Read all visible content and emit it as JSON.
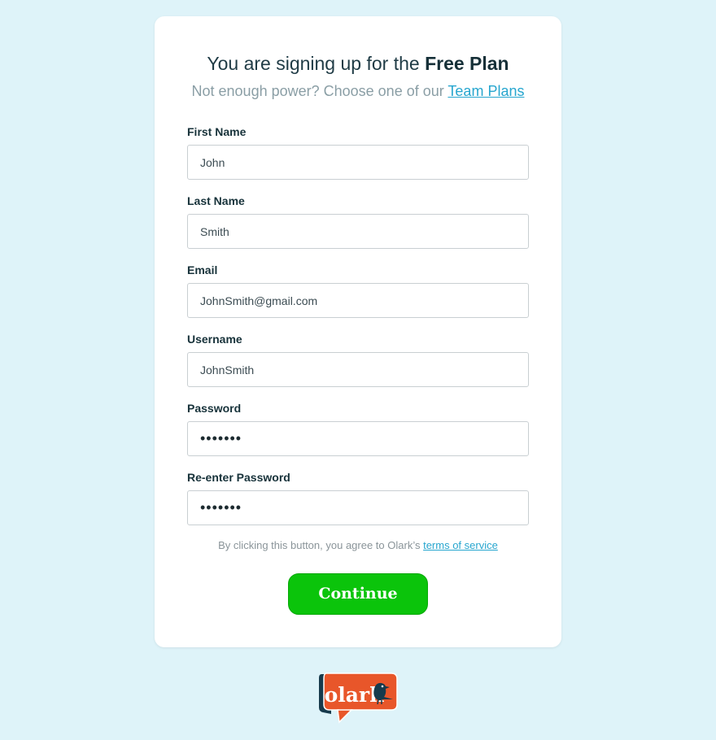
{
  "heading": {
    "prefix": "You are signing up for the ",
    "plan": "Free Plan"
  },
  "subheading": {
    "text": "Not enough power? Choose one of our ",
    "link": "Team Plans"
  },
  "form": {
    "first_name": {
      "label": "First Name",
      "value": "John"
    },
    "last_name": {
      "label": "Last Name",
      "value": "Smith"
    },
    "email": {
      "label": "Email",
      "value": "JohnSmith@gmail.com"
    },
    "username": {
      "label": "Username",
      "value": "JohnSmith"
    },
    "password": {
      "label": "Password",
      "value": "•••••••"
    },
    "reenter_password": {
      "label": "Re-enter Password",
      "value": "•••••••"
    }
  },
  "terms": {
    "text": "By clicking this button, you agree to Olark’s ",
    "link": "terms of service"
  },
  "continue_label": "Continue",
  "logo": {
    "text": "olark",
    "icon": "crow-icon"
  },
  "colors": {
    "background": "#def3f9",
    "accent": "#27a6cf",
    "button": "#0bc40b",
    "logo_orange": "#e8562a",
    "logo_navy": "#163a4c"
  }
}
